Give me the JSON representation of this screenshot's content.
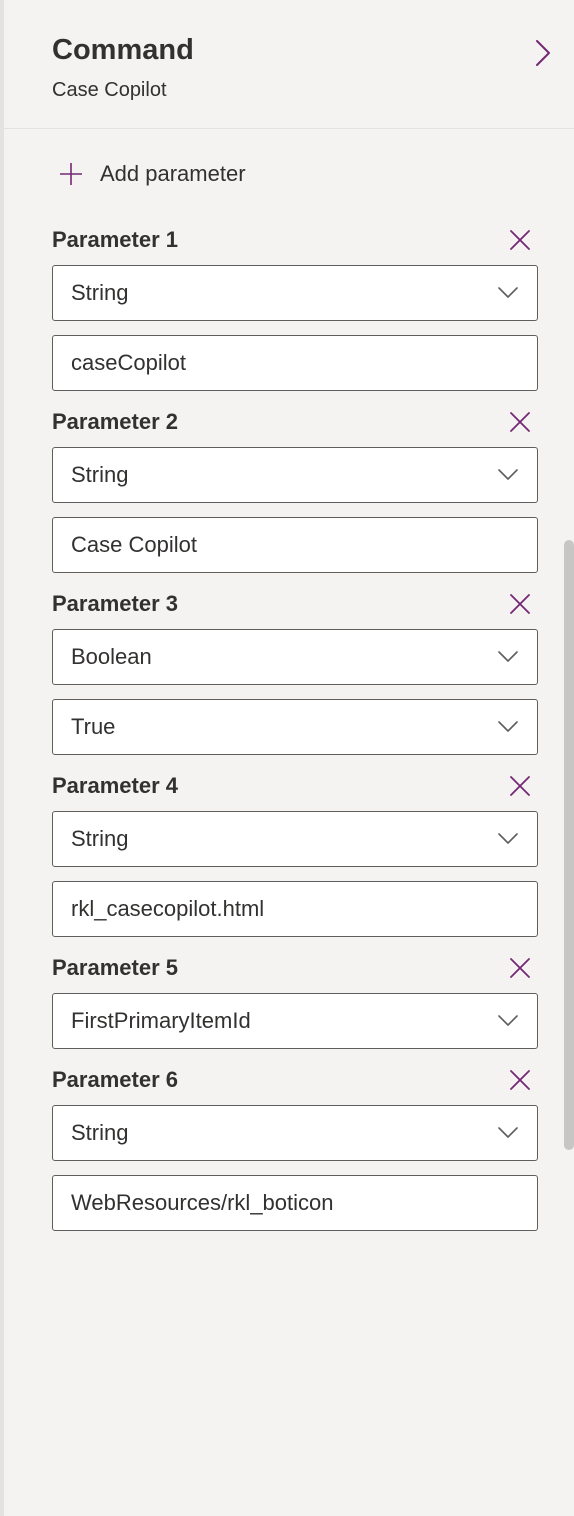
{
  "header": {
    "title": "Command",
    "subtitle": "Case Copilot"
  },
  "actions": {
    "add_parameter": "Add parameter"
  },
  "parameters": [
    {
      "label": "Parameter 1",
      "type": "String",
      "value": "caseCopilot",
      "valueKind": "input"
    },
    {
      "label": "Parameter 2",
      "type": "String",
      "value": "Case Copilot",
      "valueKind": "input"
    },
    {
      "label": "Parameter 3",
      "type": "Boolean",
      "value": "True",
      "valueKind": "select"
    },
    {
      "label": "Parameter 4",
      "type": "String",
      "value": "rkl_casecopilot.html",
      "valueKind": "input"
    },
    {
      "label": "Parameter 5",
      "type": "FirstPrimaryItemId",
      "value": null,
      "valueKind": "none"
    },
    {
      "label": "Parameter 6",
      "type": "String",
      "value": "WebResources/rkl_boticon",
      "valueKind": "input"
    }
  ],
  "colors": {
    "accent": "#742774",
    "border": "#605e5c"
  }
}
